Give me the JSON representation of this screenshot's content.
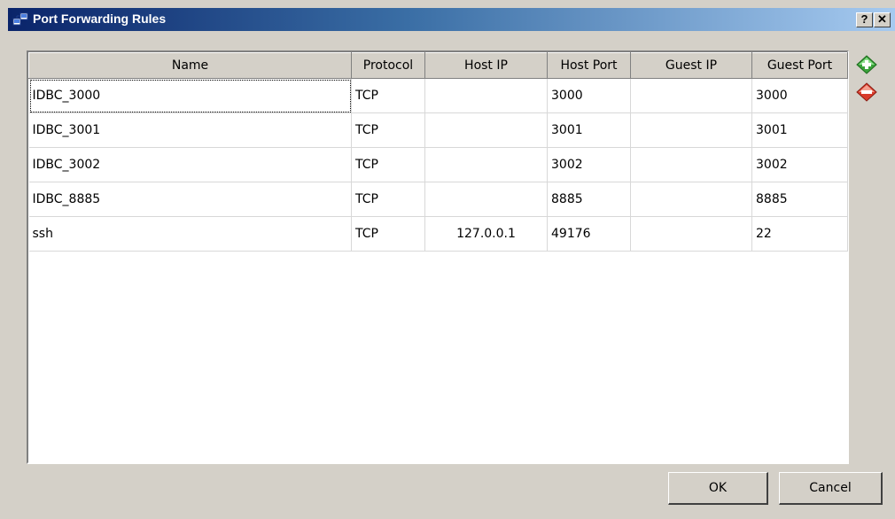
{
  "window": {
    "title": "Port Forwarding Rules",
    "help_label": "?",
    "close_label": "✕"
  },
  "table": {
    "columns": [
      "Name",
      "Protocol",
      "Host IP",
      "Host Port",
      "Guest IP",
      "Guest Port"
    ],
    "rows": [
      {
        "name": "IDBC_3000",
        "protocol": "TCP",
        "host_ip": "",
        "host_port": "3000",
        "guest_ip": "",
        "guest_port": "3000"
      },
      {
        "name": "IDBC_3001",
        "protocol": "TCP",
        "host_ip": "",
        "host_port": "3001",
        "guest_ip": "",
        "guest_port": "3001"
      },
      {
        "name": "IDBC_3002",
        "protocol": "TCP",
        "host_ip": "",
        "host_port": "3002",
        "guest_ip": "",
        "guest_port": "3002"
      },
      {
        "name": "IDBC_8885",
        "protocol": "TCP",
        "host_ip": "",
        "host_port": "8885",
        "guest_ip": "",
        "guest_port": "8885"
      },
      {
        "name": "ssh",
        "protocol": "TCP",
        "host_ip": "127.0.0.1",
        "host_port": "49176",
        "guest_ip": "",
        "guest_port": "22"
      }
    ]
  },
  "side_buttons": {
    "add_icon": "add-rule-icon",
    "remove_icon": "remove-rule-icon"
  },
  "buttons": {
    "ok_label": "OK",
    "cancel_label": "Cancel"
  },
  "colors": {
    "title_bar_start": "#0a246a",
    "title_bar_end": "#a6caf0",
    "dialog_bg": "#d4d0c8",
    "add_icon": "#3aa23a",
    "remove_icon": "#d83a2a"
  }
}
